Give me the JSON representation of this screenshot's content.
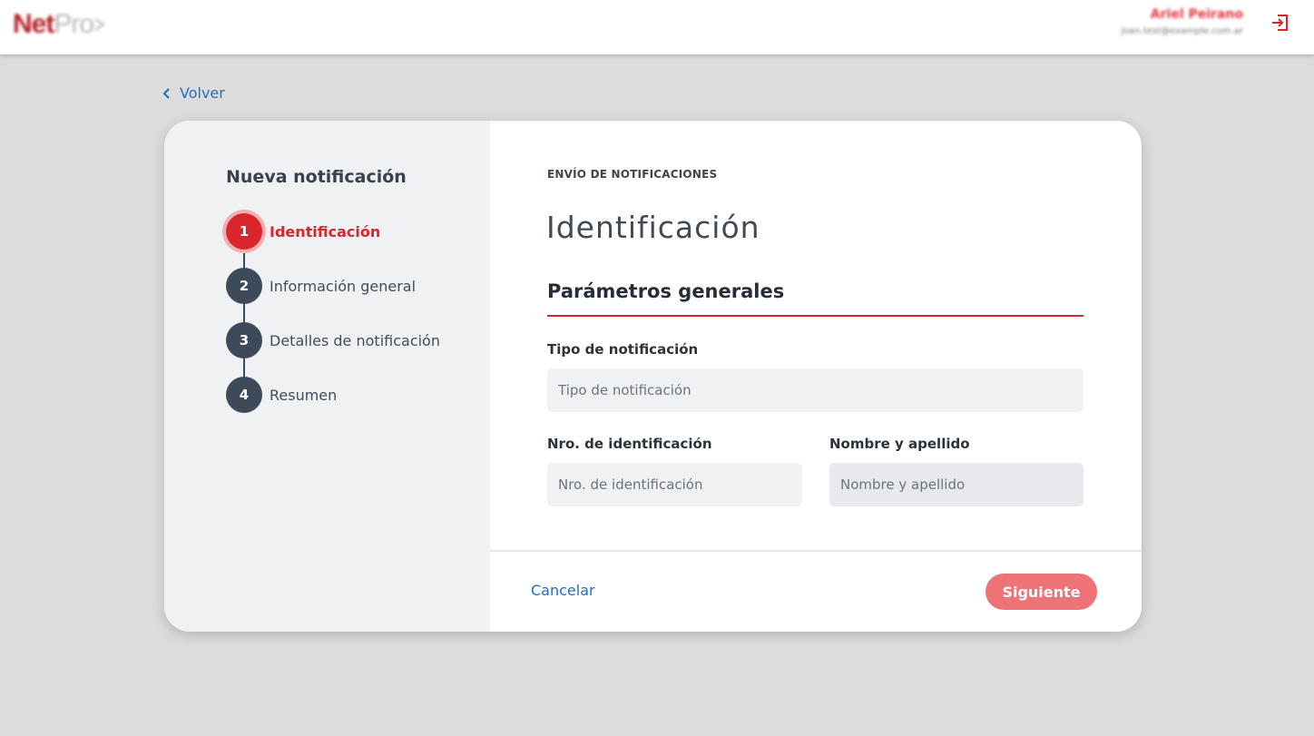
{
  "header": {
    "logo_net": "Net",
    "logo_pro": "Pro",
    "user_name": "Ariel Peirano",
    "user_email": "joan.test@example.com.ar",
    "logout_icon": "logout-icon"
  },
  "back_link": {
    "label": "Volver",
    "icon": "chevron-left-icon"
  },
  "sidebar": {
    "title": "Nueva notificación",
    "steps": [
      {
        "number": "1",
        "label": "Identificación",
        "active": true
      },
      {
        "number": "2",
        "label": "Información general",
        "active": false
      },
      {
        "number": "3",
        "label": "Detalles de notificación",
        "active": false
      },
      {
        "number": "4",
        "label": "Resumen",
        "active": false
      }
    ]
  },
  "main": {
    "eyebrow": "ENVÍO DE NOTIFICACIONES",
    "title": "Identificación",
    "section_title": "Parámetros generales",
    "fields": {
      "tipo": {
        "label": "Tipo de notificación",
        "placeholder": "Tipo de notificación",
        "value": ""
      },
      "nro": {
        "label": "Nro. de identificación",
        "placeholder": "Nro. de identificación",
        "value": ""
      },
      "nombre": {
        "label": "Nombre y apellido",
        "placeholder": "Nombre y apellido",
        "value": ""
      }
    }
  },
  "footer": {
    "cancel_label": "Cancelar",
    "next_label": "Siguiente"
  },
  "colors": {
    "accent": "#d9262d",
    "link": "#1d6fc2",
    "button_disabled": "#ee7377",
    "step_inactive": "#3e4a5a"
  }
}
